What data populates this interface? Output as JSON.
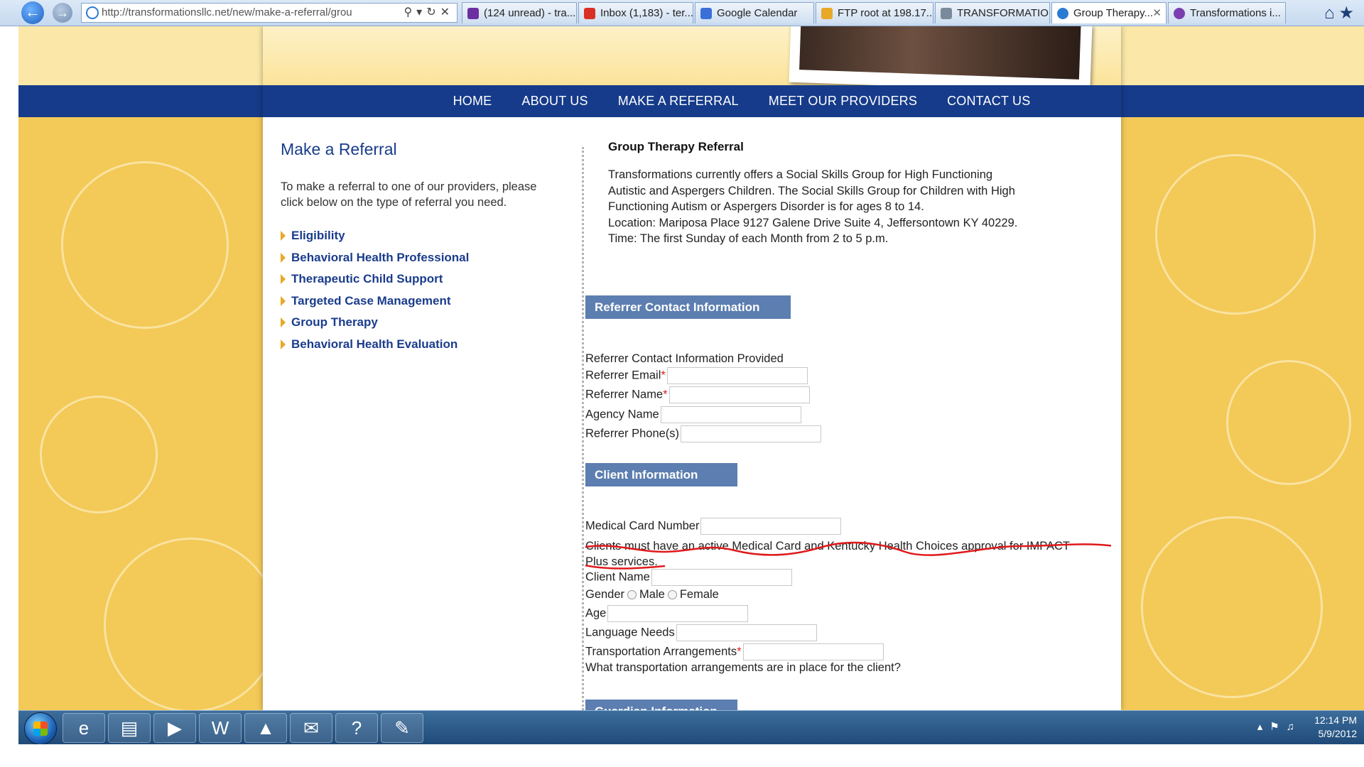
{
  "browser": {
    "address": "http://transformationsllc.net/new/make-a-referral/grou",
    "tabs": [
      {
        "label": "(124 unread) - tra...",
        "color": "#6b2fa0"
      },
      {
        "label": "Inbox (1,183) - ter...",
        "color": "#d93025"
      },
      {
        "label": "Google Calendar",
        "color": "#3b6fd8"
      },
      {
        "label": "FTP root at 198.17...",
        "color": "#e8a928"
      },
      {
        "label": "TRANSFORMATIO...",
        "color": "#7a8a9a"
      },
      {
        "label": "Group Therapy...",
        "color": "#2a7bd4"
      },
      {
        "label": "Transformations i...",
        "color": "#7b3fb0"
      }
    ]
  },
  "nav": {
    "items": [
      "HOME",
      "ABOUT US",
      "MAKE A REFERRAL",
      "MEET OUR PROVIDERS",
      "CONTACT US"
    ]
  },
  "sidebar": {
    "title": "Make a Referral",
    "intro": "To make a referral to one of our providers, please click below on the type of referral you need.",
    "links": [
      "Eligibility",
      "Behavioral Health Professional",
      "Therapeutic Child Support",
      "Targeted Case Management",
      "Group Therapy",
      "Behavioral Health Evaluation"
    ]
  },
  "main": {
    "title": "Group Therapy Referral",
    "intro_lines": [
      "Transformations currently offers a Social Skills Group for High Functioning",
      "Autistic and Aspergers Children. The Social Skills Group for Children with High",
      "Functioning Autism or Aspergers Disorder is for ages 8 to 14.",
      "Location: Mariposa Place 9127 Galene Drive Suite 4, Jeffersontown KY 40229.",
      "Time: The first Sunday of each Month from 2 to 5 p.m."
    ],
    "referrer": {
      "header": "Referrer Contact Information",
      "provided": "Referrer Contact Information Provided",
      "email": "Referrer Email",
      "name": "Referrer Name",
      "agency": "Agency Name",
      "phone": "Referrer Phone(s)"
    },
    "client": {
      "header": "Client Information",
      "medical_card": "Medical Card Number",
      "notice_line1": "Clients must have an active Medical Card and Kentucky Health Choices approval for IMPACT",
      "notice_line2": "Plus services.",
      "client_name": "Client Name",
      "gender": "Gender",
      "male": "Male",
      "female": "Female",
      "age": "Age",
      "language": "Language Needs",
      "transport": "Transportation Arrangements",
      "transport_help": "What transportation arrangements are in place for the client?"
    },
    "guardian": {
      "header": "Guardian Information"
    },
    "required_mark": "*"
  },
  "taskbar": {
    "time": "12:14 PM",
    "date": "5/9/2012"
  },
  "colors": {
    "nav_bg": "#163b8a",
    "section_bg": "#5c7eb0",
    "link": "#1a3c8c",
    "page_bg": "#f3c958",
    "annotation": "#e0191b"
  }
}
